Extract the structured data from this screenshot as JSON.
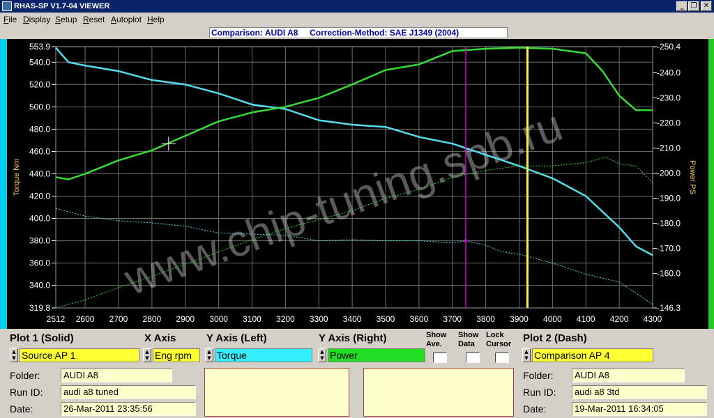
{
  "window": {
    "title": "RHAS-SP V1.7-04  VIEWER",
    "controls": {
      "minimize": "_",
      "restore": "❐",
      "close": "✕"
    }
  },
  "menu": [
    {
      "acc": "F",
      "rest": "ile"
    },
    {
      "acc": "D",
      "rest": "isplay"
    },
    {
      "acc": "S",
      "rest": "etup"
    },
    {
      "acc": "R",
      "rest": "eset"
    },
    {
      "acc": "A",
      "rest": "utoplot"
    },
    {
      "acc": "H",
      "rest": "elp"
    }
  ],
  "banner": "Comparison: AUDI A8     Correction-Method: SAE J1349 (2004)",
  "watermark": "www.chip-tuning.spb.ru",
  "colors": {
    "torque": "#55ddee",
    "power": "#33dd33",
    "cursor_magenta": "#cc00cc",
    "cursor_yellow": "#ffee44",
    "grid": "#707070",
    "axis_text": "#ffffff",
    "left_axis_label": "#ffcc66",
    "right_axis_label": "#ffcc66",
    "plot1_source_bg": "#ffff33",
    "yaxis_left_bg": "#33eeff",
    "yaxis_right_bg": "#22dd22",
    "plot2_source_bg": "#ffff33"
  },
  "chart_data": {
    "type": "line",
    "xlabel": "",
    "ylabel_left": "Torque Nm",
    "ylabel_right": "Power PS",
    "x_ticks": [
      "2512",
      "2600",
      "2700",
      "2800",
      "2900",
      "3000",
      "3100",
      "3200",
      "3300",
      "3400",
      "3500",
      "3600",
      "3700",
      "3800",
      "3900",
      "4000",
      "4100",
      "4200",
      "4300"
    ],
    "xlim": [
      2512,
      4300
    ],
    "y_left_ticks": [
      "553.9",
      "540.0",
      "520.0",
      "500.0",
      "480.0",
      "460.0",
      "440.0",
      "420.0",
      "400.0",
      "380.0",
      "360.0",
      "340.0",
      "319.8"
    ],
    "ylim_left": [
      319.8,
      553.9
    ],
    "y_right_ticks": [
      "250.4",
      "240.0",
      "230.0",
      "220.0",
      "210.0",
      "200.0",
      "190.0",
      "180.0",
      "170.0",
      "160.0",
      "146.3"
    ],
    "ylim_right": [
      146.3,
      250.4
    ],
    "grid": true,
    "series": [
      {
        "name": "Torque",
        "axis": "left",
        "style": "solid",
        "x": [
          2512,
          2550,
          2600,
          2700,
          2800,
          2900,
          3000,
          3100,
          3200,
          3300,
          3400,
          3500,
          3600,
          3700,
          3800,
          3900,
          4000,
          4100,
          4200,
          4250,
          4300
        ],
        "y": [
          553,
          540,
          537,
          532,
          524,
          520,
          512,
          502,
          498,
          488,
          484,
          482,
          473,
          467,
          457,
          447,
          436,
          420,
          392,
          375,
          367
        ]
      },
      {
        "name": "Power",
        "axis": "left",
        "style": "solid",
        "x": [
          2512,
          2550,
          2600,
          2700,
          2800,
          2900,
          3000,
          3100,
          3200,
          3300,
          3400,
          3500,
          3600,
          3700,
          3800,
          3900,
          4000,
          4100,
          4150,
          4200,
          4250,
          4300
        ],
        "y": [
          437,
          435,
          440,
          452,
          461,
          474,
          487,
          495,
          500,
          508,
          520,
          533,
          538,
          550,
          552,
          553,
          552,
          548,
          532,
          510,
          497,
          497
        ]
      },
      {
        "name": "Torque",
        "axis": "left",
        "style": "dash",
        "x": [
          2512,
          2600,
          2700,
          2800,
          2900,
          3000,
          3100,
          3200,
          3300,
          3400,
          3500,
          3600,
          3700,
          3740,
          3800,
          3850,
          3900,
          4000,
          4100,
          4200,
          4300
        ],
        "y": [
          409,
          402,
          398,
          396,
          393,
          387,
          386,
          385,
          380,
          381,
          380,
          380,
          378,
          380,
          376,
          370,
          368,
          360,
          350,
          343,
          323
        ]
      },
      {
        "name": "Power",
        "axis": "left",
        "style": "dash",
        "x": [
          2512,
          2600,
          2700,
          2800,
          2900,
          3000,
          3100,
          3200,
          3300,
          3400,
          3500,
          3600,
          3700,
          3800,
          3900,
          4000,
          4100,
          4160,
          4200,
          4250,
          4300
        ],
        "y": [
          320,
          327,
          338,
          348,
          359,
          370,
          381,
          391,
          399,
          407,
          418,
          426,
          437,
          443,
          447,
          447,
          450,
          455,
          449,
          447,
          432
        ]
      }
    ],
    "cursors": [
      {
        "x": 3740,
        "color": "magenta"
      },
      {
        "x": 3925,
        "color": "yellow"
      }
    ],
    "crosshair": {
      "x": 2850,
      "y": 467
    }
  },
  "panel": {
    "plot1": {
      "header": "Plot 1 (Solid)",
      "source": "Source AP 1",
      "folder_label": "Folder:",
      "folder": "AUDI A8",
      "runid_label": "Run ID:",
      "runid": "audi a8 tuned",
      "date_label": "Date:",
      "date": "26-Mar-2011  23:35:56"
    },
    "xaxis": {
      "header": "X Axis",
      "value": "Eng rpm"
    },
    "yaxis_left": {
      "header": "Y Axis (Left)",
      "value": "Torque"
    },
    "yaxis_right": {
      "header": "Y Axis (Right)",
      "value": "Power"
    },
    "show_ave": {
      "line1": "Show",
      "line2": "Ave."
    },
    "show_data": {
      "line1": "Show",
      "line2": "Data"
    },
    "lock_cursor": {
      "line1": "Lock",
      "line2": "Cursor"
    },
    "plot2": {
      "header": "Plot 2 (Dash)",
      "source": "Comparison AP 4",
      "folder_label": "Folder:",
      "folder": "AUDI A8",
      "runid_label": "Run ID:",
      "runid": "audi a8 3td",
      "date_label": "Date:",
      "date": "19-Mar-2011  16:34:05"
    }
  }
}
